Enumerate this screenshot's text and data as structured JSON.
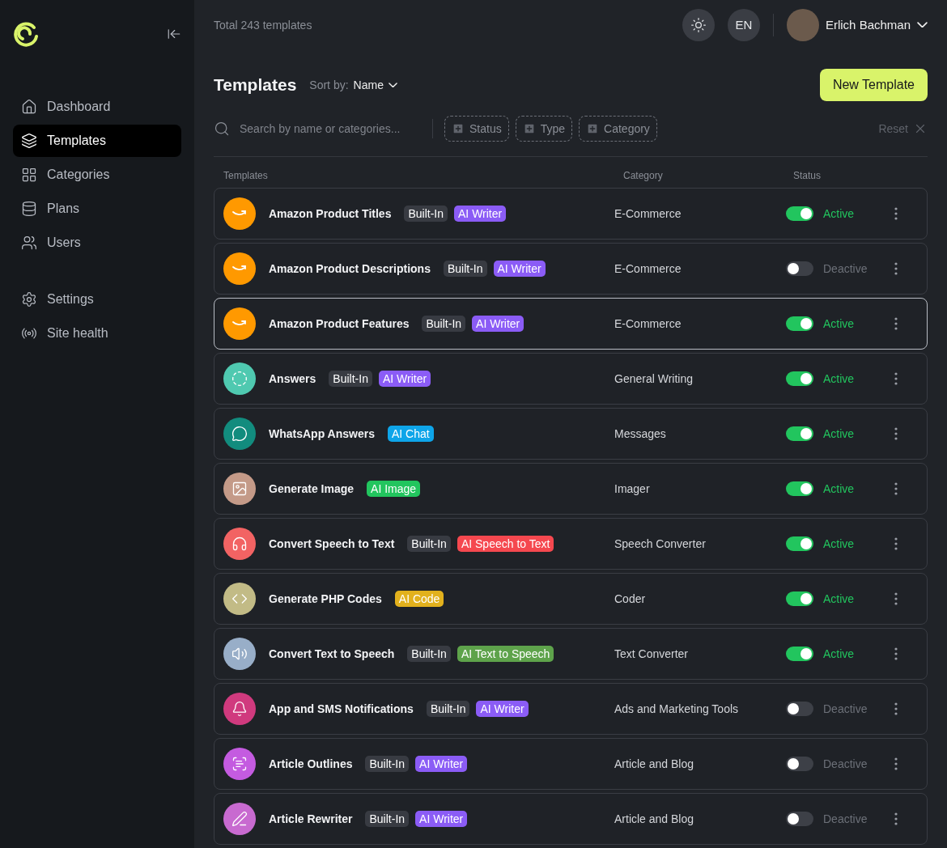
{
  "sidebar": {
    "items": [
      {
        "label": "Dashboard",
        "selected": false
      },
      {
        "label": "Templates",
        "selected": true
      },
      {
        "label": "Categories",
        "selected": false
      },
      {
        "label": "Plans",
        "selected": false
      },
      {
        "label": "Users",
        "selected": false
      }
    ],
    "bottom_items": [
      {
        "label": "Settings",
        "selected": false
      },
      {
        "label": "Site health",
        "selected": false
      }
    ]
  },
  "topbar": {
    "total": "Total 243 templates",
    "language": "EN",
    "user": "Erlich Bachman"
  },
  "header": {
    "title": "Templates",
    "sort_label": "Sort by:",
    "sort_value": "Name",
    "new_button": "New Template"
  },
  "filters": {
    "search_placeholder": "Search by name or categories...",
    "chips": [
      "Status",
      "Type",
      "Category"
    ],
    "reset": "Reset"
  },
  "table": {
    "columns": [
      "Templates",
      "Category",
      "Status"
    ],
    "rows": [
      {
        "name": "Amazon Product Titles",
        "color": "#ff9900",
        "tags": [
          {
            "label": "Built-In",
            "color": "#383b42"
          },
          {
            "label": "AI Writer",
            "color": "#8b5cf6"
          }
        ],
        "category": "E-Commerce",
        "active": true,
        "status": "Active",
        "selected": false
      },
      {
        "name": "Amazon Product Descriptions",
        "color": "#ff9900",
        "tags": [
          {
            "label": "Built-In",
            "color": "#383b42"
          },
          {
            "label": "AI Writer",
            "color": "#8b5cf6"
          }
        ],
        "category": "E-Commerce",
        "active": false,
        "status": "Deactive",
        "selected": false
      },
      {
        "name": "Amazon Product Features",
        "color": "#ff9900",
        "tags": [
          {
            "label": "Built-In",
            "color": "#383b42"
          },
          {
            "label": "AI Writer",
            "color": "#8b5cf6"
          }
        ],
        "category": "E-Commerce",
        "active": true,
        "status": "Active",
        "selected": true
      },
      {
        "name": "Answers",
        "color": "#4fc9b0",
        "tags": [
          {
            "label": "Built-In",
            "color": "#383b42"
          },
          {
            "label": "AI Writer",
            "color": "#8b5cf6"
          }
        ],
        "category": "General Writing",
        "active": true,
        "status": "Active",
        "selected": false
      },
      {
        "name": "WhatsApp Answers",
        "color": "#128c7e",
        "tags": [
          {
            "label": "AI Chat",
            "color": "#0ea5e9"
          }
        ],
        "category": "Messages",
        "active": true,
        "status": "Active",
        "selected": false
      },
      {
        "name": "Generate Image",
        "color": "#c49a88",
        "tags": [
          {
            "label": "AI Image",
            "color": "#22c55e"
          }
        ],
        "category": "Imager",
        "active": true,
        "status": "Active",
        "selected": false
      },
      {
        "name": "Convert Speech to Text",
        "color": "#f26363",
        "tags": [
          {
            "label": "Built-In",
            "color": "#383b42"
          },
          {
            "label": "AI Speech to Text",
            "color": "#f5484f"
          }
        ],
        "category": "Speech Converter",
        "active": true,
        "status": "Active",
        "selected": false
      },
      {
        "name": "Generate PHP Codes",
        "color": "#c2bb86",
        "tags": [
          {
            "label": "AI Code",
            "color": "#e2b11d"
          }
        ],
        "category": "Coder",
        "active": true,
        "status": "Active",
        "selected": false
      },
      {
        "name": "Convert Text to Speech",
        "color": "#98aec8",
        "tags": [
          {
            "label": "Built-In",
            "color": "#383b42"
          },
          {
            "label": "AI Text to Speech",
            "color": "#5ea34b"
          }
        ],
        "category": "Text Converter",
        "active": true,
        "status": "Active",
        "selected": false
      },
      {
        "name": "App and SMS Notifications",
        "color": "#d03a7e",
        "tags": [
          {
            "label": "Built-In",
            "color": "#383b42"
          },
          {
            "label": "AI Writer",
            "color": "#8b5cf6"
          }
        ],
        "category": "Ads and Marketing Tools",
        "active": false,
        "status": "Deactive",
        "selected": false
      },
      {
        "name": "Article Outlines",
        "color": "#c45be0",
        "tags": [
          {
            "label": "Built-In",
            "color": "#383b42"
          },
          {
            "label": "AI Writer",
            "color": "#8b5cf6"
          }
        ],
        "category": "Article and Blog",
        "active": false,
        "status": "Deactive",
        "selected": false
      },
      {
        "name": "Article Rewriter",
        "color": "#c86ad0",
        "tags": [
          {
            "label": "Built-In",
            "color": "#383b42"
          },
          {
            "label": "AI Writer",
            "color": "#8b5cf6"
          }
        ],
        "category": "Article and Blog",
        "active": false,
        "status": "Deactive",
        "selected": false
      }
    ]
  }
}
